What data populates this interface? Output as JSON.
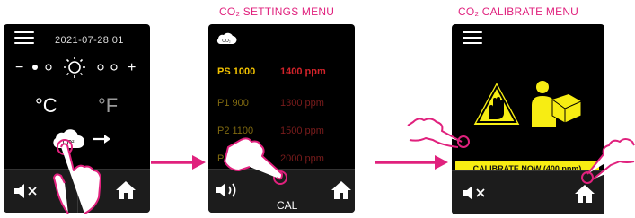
{
  "colors": {
    "accent": "#e0217d",
    "warning_yellow": "#f7ed13",
    "active_label": "#f2c200",
    "active_value": "#d2232a"
  },
  "screen1": {
    "datetime": "2021-07-28  01",
    "brightness": {
      "minus": "−",
      "plus": "+"
    },
    "units": {
      "celsius": "°C",
      "fahrenheit": "°F"
    },
    "co2_button_label": "CO²",
    "icons": [
      "menu-icon",
      "sun-icon",
      "cloud-icon",
      "arrow-right-icon",
      "speaker-muted-icon",
      "home-icon"
    ]
  },
  "screen2": {
    "title": "CO₂ SETTINGS MENU",
    "cloud_label": "CO₂",
    "rows": [
      {
        "label": "PS  1000",
        "value": "1400 ppm"
      },
      {
        "label": "P1   900",
        "value": "1300 ppm"
      },
      {
        "label": "P2  1100",
        "value": "1500 ppm"
      },
      {
        "label": "P3",
        "value": "2000 ppm"
      }
    ],
    "cal_label": "CAL"
  },
  "screen3": {
    "title": "CO₂ CALIBRATE MENU",
    "calibrate_button": "CALIBRATE NOW (400 ppm)"
  }
}
